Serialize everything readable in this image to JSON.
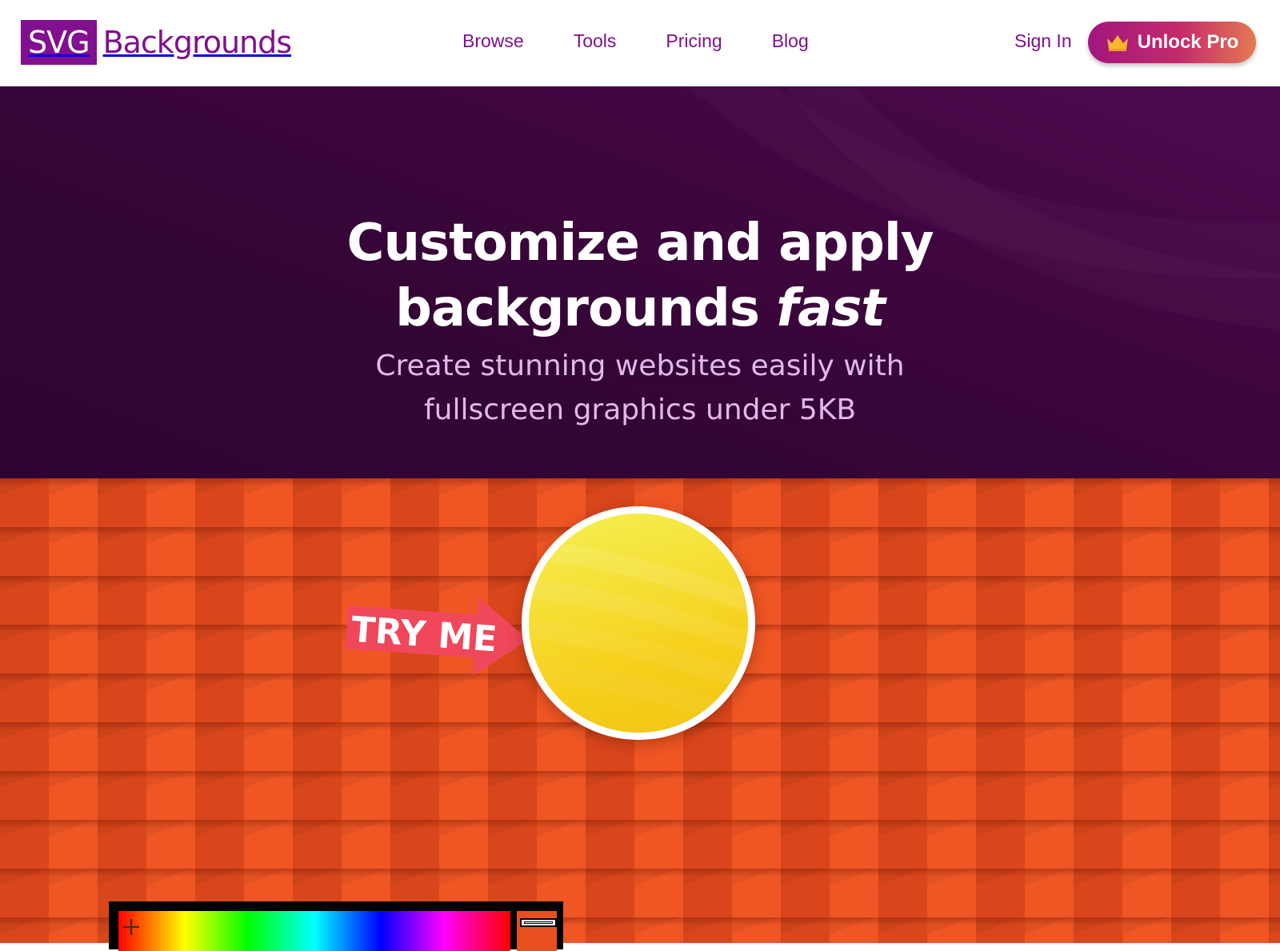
{
  "header": {
    "logo_box": "SVG",
    "logo_text": "Backgrounds",
    "nav": [
      "Browse",
      "Tools",
      "Pricing",
      "Blog"
    ],
    "sign_in": "Sign In",
    "pro_button": "Unlock Pro",
    "pro_icon": "crown-icon"
  },
  "hero": {
    "title_line1": "Customize and apply",
    "title_line2_plain": "backgrounds ",
    "title_line2_em": "fast",
    "subtitle_line1": "Create stunning websites easily with",
    "subtitle_line2": "fullscreen graphics under 5KB"
  },
  "try_me": {
    "label": "TRY ME",
    "arrow_color": "#f0475a"
  },
  "colors": {
    "brand": "#80108e",
    "hero_bg": "#330534",
    "pattern_orange": "#e85020",
    "circle_yellow": "#f6d21f"
  },
  "color_picker": {
    "cursor_icon": "crosshair-icon",
    "selected_color": "#e85020"
  }
}
